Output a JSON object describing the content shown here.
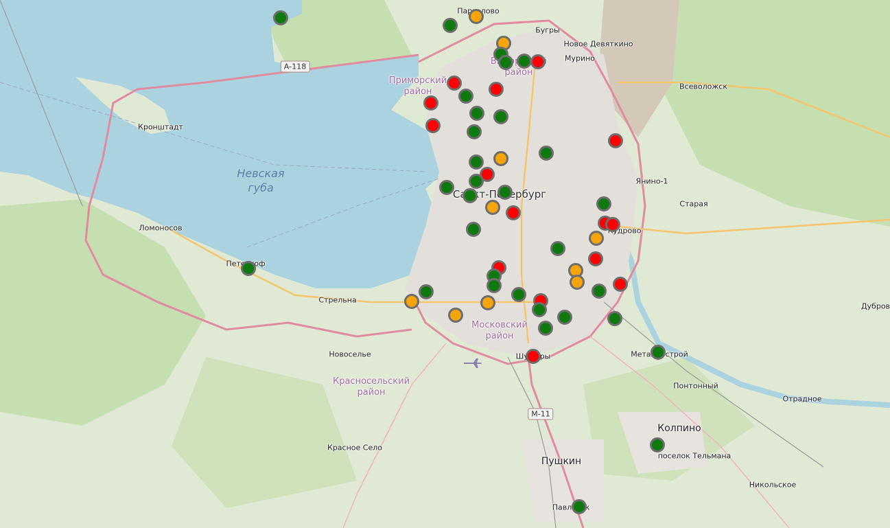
{
  "colors": {
    "water": "#aad3df",
    "land": "#dfe9d3",
    "forest": "#c6dfb0",
    "urban": "#e3e0dc",
    "ring_road": "#e08ba0",
    "major_road": "#f4c56d",
    "ok": "#0e7a0e",
    "warning": "#f5a50b",
    "alert": "#ff0000"
  },
  "places": [
    {
      "id": "pargolovo",
      "label": "Парголово",
      "size": "s"
    },
    {
      "id": "bugry",
      "label": "Бугры",
      "size": "s"
    },
    {
      "id": "novoe-devyatkino",
      "label": "Новое Девяткино",
      "size": "s"
    },
    {
      "id": "murino",
      "label": "Мурино",
      "size": "s"
    },
    {
      "id": "vsevolozhsk",
      "label": "Всеволожск",
      "size": "s"
    },
    {
      "id": "kronshtadt",
      "label": "Кронштадт",
      "size": "s"
    },
    {
      "id": "yanino",
      "label": "Янино-1",
      "size": "s"
    },
    {
      "id": "staraya",
      "label": "Старая",
      "size": "s"
    },
    {
      "id": "spb",
      "label": "Санкт-Петербург",
      "size": "l"
    },
    {
      "id": "kudrovo",
      "label": "Кудрово",
      "size": "s"
    },
    {
      "id": "lomonosov",
      "label": "Ломоносов",
      "size": "s"
    },
    {
      "id": "petergof",
      "label": "Петергоф",
      "size": "s"
    },
    {
      "id": "strelna",
      "label": "Стрельна",
      "size": "s"
    },
    {
      "id": "novosele",
      "label": "Новоселье",
      "size": "s"
    },
    {
      "id": "shushary",
      "label": "Шушары",
      "size": "s"
    },
    {
      "id": "metallostroy",
      "label": "Металлострой",
      "size": "s"
    },
    {
      "id": "pontonny",
      "label": "Понтонный",
      "size": "s"
    },
    {
      "id": "otradnoe",
      "label": "Отрадное",
      "size": "s"
    },
    {
      "id": "kolpino",
      "label": "Колпино",
      "size": "m"
    },
    {
      "id": "telmana",
      "label": "поселок Тельмана",
      "size": "s"
    },
    {
      "id": "krasnoe-selo",
      "label": "Красное Село",
      "size": "s"
    },
    {
      "id": "pushkin",
      "label": "Пушкин",
      "size": "m"
    },
    {
      "id": "pavlovsk",
      "label": "Павловск",
      "size": "s"
    },
    {
      "id": "nikolskoe",
      "label": "Никольское",
      "size": "s"
    },
    {
      "id": "dubrovka",
      "label": "Дубров",
      "size": "s"
    }
  ],
  "districts": [
    {
      "id": "primorsky",
      "line1": "Приморский",
      "line2": "район"
    },
    {
      "id": "vyborgsky",
      "line1": "Выборгский",
      "line2": "район"
    },
    {
      "id": "moskovsky",
      "line1": "Московский",
      "line2": "район"
    },
    {
      "id": "krasnoselsky",
      "line1": "Красносельский",
      "line2": "район"
    }
  ],
  "water_labels": [
    {
      "id": "nevskaya-guba",
      "line1": "Невская",
      "line2": "губа"
    }
  ],
  "road_shields": [
    {
      "id": "a118",
      "label": "А-118"
    },
    {
      "id": "m11",
      "label": "М-11"
    }
  ],
  "markers": [
    {
      "status": "ok"
    },
    {
      "status": "warning"
    },
    {
      "status": "ok"
    },
    {
      "status": "warning"
    },
    {
      "status": "ok"
    },
    {
      "status": "ok"
    },
    {
      "status": "ok"
    },
    {
      "status": "alert"
    },
    {
      "status": "alert"
    },
    {
      "status": "ok"
    },
    {
      "status": "alert"
    },
    {
      "status": "alert"
    },
    {
      "status": "ok"
    },
    {
      "status": "ok"
    },
    {
      "status": "alert"
    },
    {
      "status": "ok"
    },
    {
      "status": "alert"
    },
    {
      "status": "ok"
    },
    {
      "status": "warning"
    },
    {
      "status": "alert"
    },
    {
      "status": "ok"
    },
    {
      "status": "ok"
    },
    {
      "status": "ok"
    },
    {
      "status": "ok"
    },
    {
      "status": "warning"
    },
    {
      "status": "alert"
    },
    {
      "status": "ok"
    },
    {
      "status": "ok"
    },
    {
      "status": "alert"
    },
    {
      "status": "alert"
    },
    {
      "status": "warning"
    },
    {
      "status": "ok"
    },
    {
      "status": "alert"
    },
    {
      "status": "warning"
    },
    {
      "status": "warning"
    },
    {
      "status": "alert"
    },
    {
      "status": "ok"
    },
    {
      "status": "ok"
    },
    {
      "status": "alert"
    },
    {
      "status": "ok"
    },
    {
      "status": "warning"
    },
    {
      "status": "ok"
    },
    {
      "status": "warning"
    },
    {
      "status": "ok"
    },
    {
      "status": "warning"
    },
    {
      "status": "ok"
    },
    {
      "status": "alert"
    },
    {
      "status": "ok"
    },
    {
      "status": "ok"
    },
    {
      "status": "ok"
    },
    {
      "status": "ok"
    },
    {
      "status": "alert"
    },
    {
      "status": "ok"
    },
    {
      "status": "ok"
    },
    {
      "status": "ok"
    },
    {
      "status": "ok"
    }
  ]
}
